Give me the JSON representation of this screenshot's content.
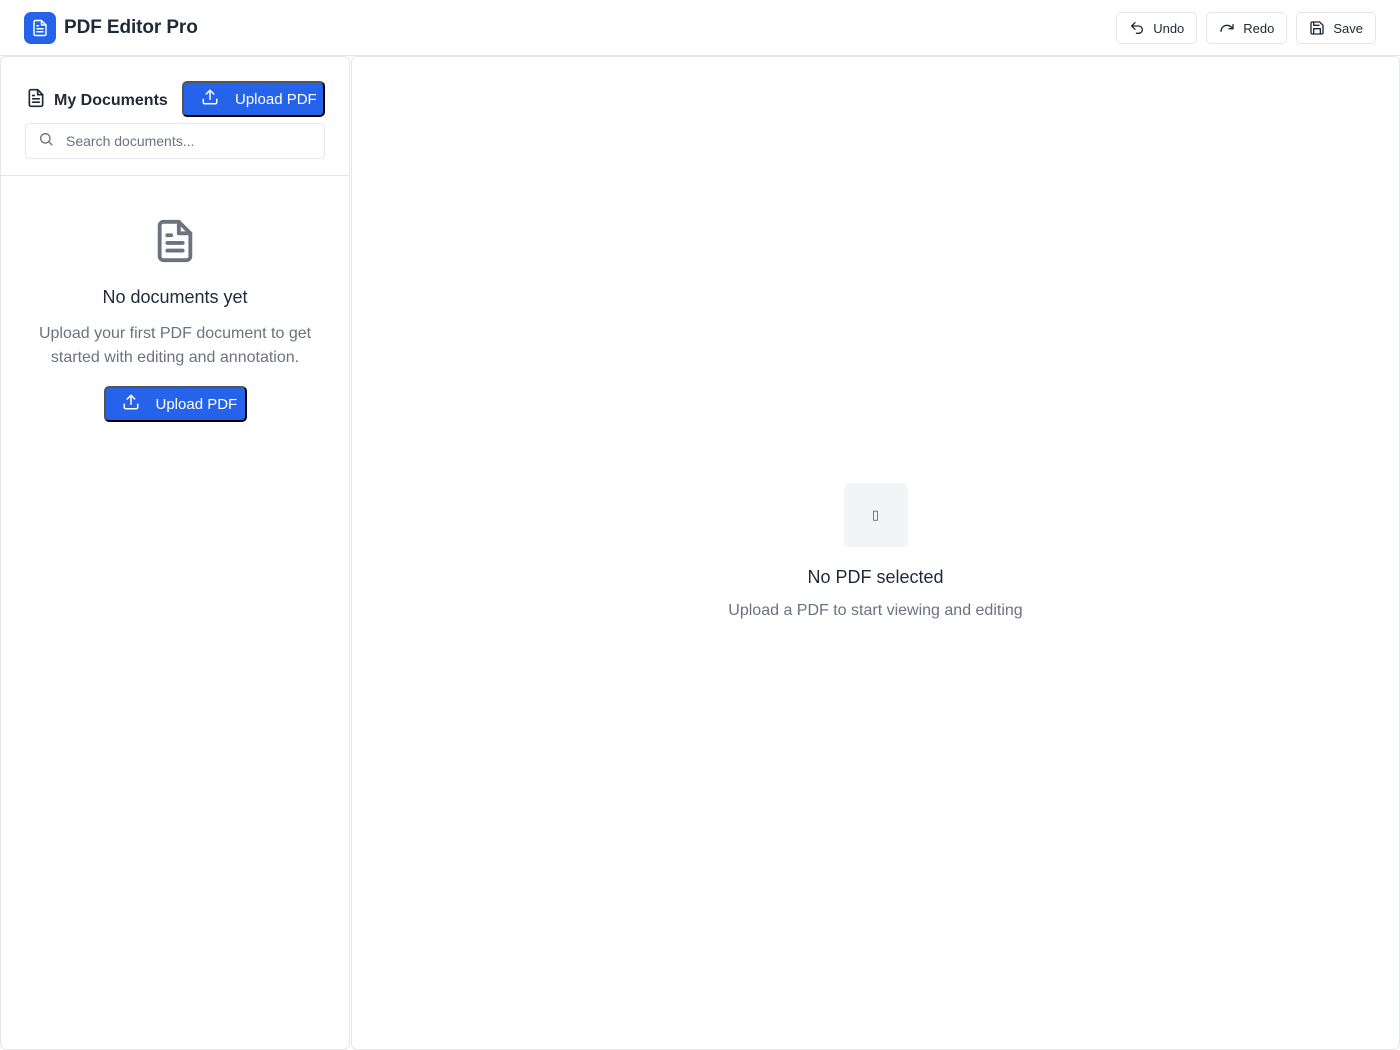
{
  "app": {
    "title": "PDF Editor Pro"
  },
  "toolbar": {
    "undo_label": "Undo",
    "redo_label": "Redo",
    "save_label": "Save"
  },
  "sidebar": {
    "title": "My Documents",
    "upload_label": "Upload PDF",
    "search_placeholder": "Search documents...",
    "empty_title": "No documents yet",
    "empty_text": "Upload your first PDF document to get started with editing and annotation.",
    "empty_upload_label": "Upload PDF"
  },
  "viewer": {
    "placeholder_glyph": "▯",
    "empty_title": "No PDF selected",
    "empty_text": "Upload a PDF to start viewing and editing"
  },
  "colors": {
    "accent": "#2563eb",
    "border": "#e5e7eb",
    "muted_text": "#6b7280"
  },
  "icons": [
    "file-text-icon",
    "undo-icon",
    "redo-icon",
    "save-icon",
    "upload-icon",
    "search-icon"
  ]
}
